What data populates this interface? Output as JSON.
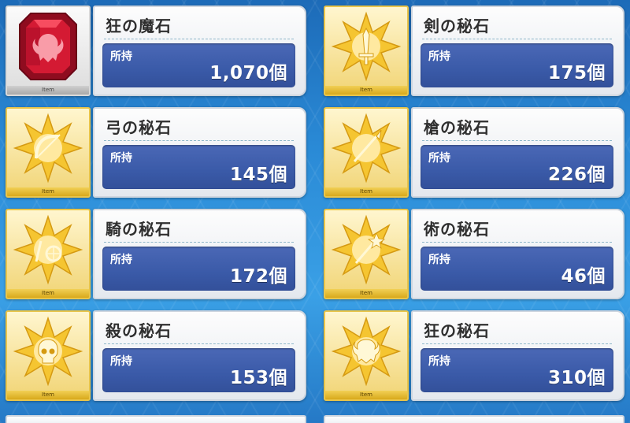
{
  "items": [
    {
      "name": "狂の魔石",
      "held_label": "所持",
      "quantity": "1,070個",
      "tag": "Item",
      "icon": "red-gem-icon",
      "frame": "silver"
    },
    {
      "name": "剣の秘石",
      "held_label": "所持",
      "quantity": "175個",
      "tag": "Item",
      "icon": "sword-star-icon",
      "frame": "gold"
    },
    {
      "name": "弓の秘石",
      "held_label": "所持",
      "quantity": "145個",
      "tag": "Item",
      "icon": "bow-star-icon",
      "frame": "gold"
    },
    {
      "name": "槍の秘石",
      "held_label": "所持",
      "quantity": "226個",
      "tag": "Item",
      "icon": "lance-star-icon",
      "frame": "gold"
    },
    {
      "name": "騎の秘石",
      "held_label": "所持",
      "quantity": "172個",
      "tag": "Item",
      "icon": "rider-star-icon",
      "frame": "gold"
    },
    {
      "name": "術の秘石",
      "held_label": "所持",
      "quantity": "46個",
      "tag": "Item",
      "icon": "staff-star-icon",
      "frame": "gold"
    },
    {
      "name": "殺の秘石",
      "held_label": "所持",
      "quantity": "153個",
      "tag": "Item",
      "icon": "skull-star-icon",
      "frame": "gold"
    },
    {
      "name": "狂の秘石",
      "held_label": "所持",
      "quantity": "310個",
      "tag": "Item",
      "icon": "beast-star-icon",
      "frame": "gold"
    }
  ],
  "colors": {
    "gem_red": "#c8102e",
    "star_gold": "#f5c531",
    "panel_blue": "#3a5aa8",
    "background_blue": "#2a8ad6"
  }
}
